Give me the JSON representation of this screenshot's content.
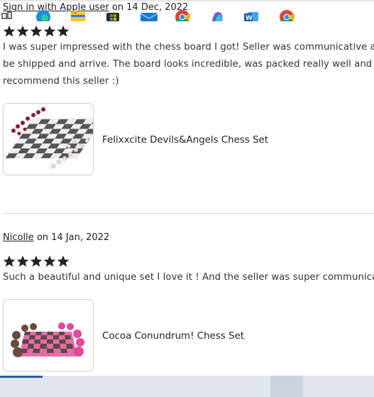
{
  "reviews": [
    {
      "reviewer": "Sign in with Apple user",
      "date_text": "on 14 Dec, 2022",
      "rating": 5,
      "text_lines": [
        "I was super impressed with the chess board I got! Seller was communicative an",
        "be shipped and arrive. The board looks incredible, was packed really well and t",
        "recommend this seller :)"
      ],
      "product_name": "Felixxcite Devils&Angels Chess Set"
    },
    {
      "reviewer": "Nicolle",
      "date_text": "on 14 Jan, 2022",
      "rating": 5,
      "text_lines": [
        "Such a beautiful and unique set I love it ! And the seller was super communicat"
      ],
      "product_name": "Cocoa Conundrum! Chess Set"
    }
  ],
  "taskbar": {
    "icons": [
      "task-view-icon",
      "edge-icon",
      "file-explorer-icon",
      "microsoft-store-icon",
      "mail-icon",
      "chrome-icon",
      "copilot-icon",
      "word-icon",
      "chrome-active-icon"
    ]
  },
  "colors": {
    "star": "#222222",
    "divider": "#dcdcdc",
    "taskbar": "#dfe6ee"
  }
}
